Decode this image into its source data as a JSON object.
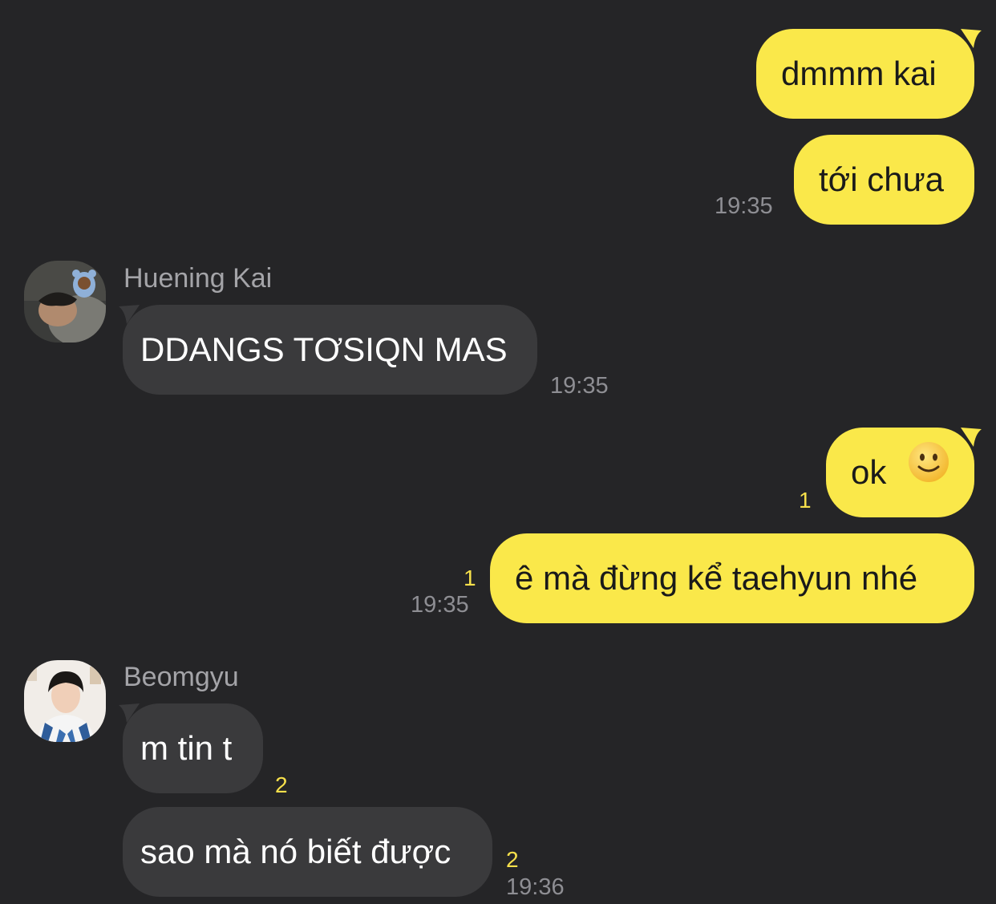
{
  "messages": [
    {
      "id": "m1",
      "side": "outgoing",
      "text": "dmmm kai"
    },
    {
      "id": "m2",
      "side": "outgoing",
      "text": "tới chưa",
      "time": "19:35"
    },
    {
      "id": "m3",
      "side": "incoming",
      "sender": "Huening Kai",
      "text": "DDANGS TƠSIQN MAS",
      "time": "19:35"
    },
    {
      "id": "m4",
      "side": "outgoing",
      "text": "ok",
      "emoji": "slightly-smiling-face",
      "unread": "1"
    },
    {
      "id": "m5",
      "side": "outgoing",
      "text": "ê mà đừng kể taehyun nhé",
      "unread": "1",
      "time": "19:35"
    },
    {
      "id": "m6",
      "side": "incoming",
      "sender": "Beomgyu",
      "text": "m tin t",
      "unread": "2"
    },
    {
      "id": "m7",
      "side": "incoming",
      "text": "sao mà nó biết được",
      "unread": "2",
      "time": "19:36"
    }
  ],
  "colors": {
    "background": "#252527",
    "outgoing_bubble": "#fae84a",
    "incoming_bubble": "#3a3a3c",
    "unread_count": "#f7e04b",
    "timestamp": "#8e8e93"
  }
}
